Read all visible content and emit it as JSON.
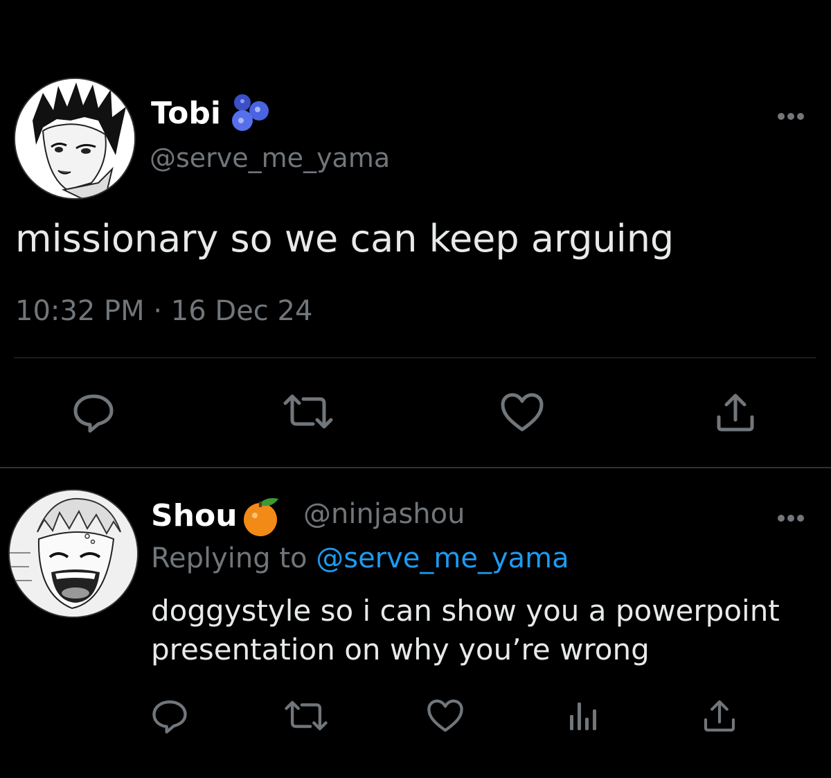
{
  "main_tweet": {
    "display_name": "Tobi",
    "name_emoji": "blueberries-emoji",
    "handle": "@serve_me_yama",
    "text": "missionary so we can keep arguing",
    "time": "10:32 PM",
    "separator": "·",
    "date": "16 Dec 24",
    "actions": [
      "reply-icon",
      "retweet-icon",
      "like-icon",
      "share-icon"
    ]
  },
  "reply_tweet": {
    "display_name": "Shou",
    "name_emoji": "tangerine-emoji",
    "handle": "@ninjashou",
    "replying_prefix": "Replying to",
    "replying_handle": "@serve_me_yama",
    "text_line1": "doggystyle so i can show you a powerpoint",
    "text_line2": "presentation on why you’re wrong",
    "actions": [
      "reply-icon",
      "retweet-icon",
      "like-icon",
      "analytics-icon",
      "share-icon"
    ]
  },
  "colors": {
    "background": "#000000",
    "text_primary": "#e7e9ea",
    "text_secondary": "#71767b",
    "link": "#1d9bf0",
    "divider": "#2f3336"
  }
}
